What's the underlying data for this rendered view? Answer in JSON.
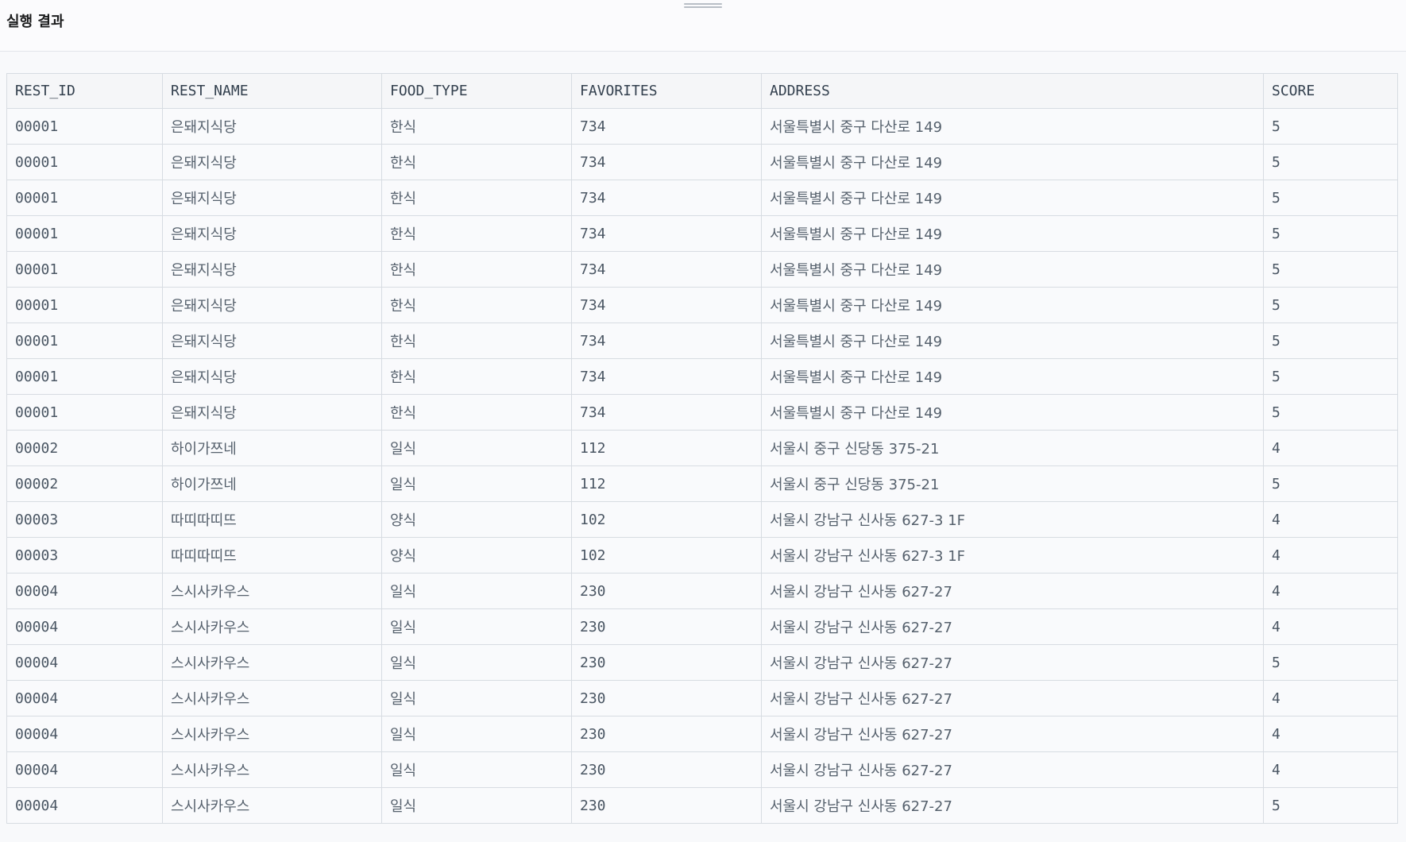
{
  "panel": {
    "title": "실행 결과"
  },
  "table": {
    "columns": [
      "REST_ID",
      "REST_NAME",
      "FOOD_TYPE",
      "FAVORITES",
      "ADDRESS",
      "SCORE"
    ],
    "rows": [
      [
        "00001",
        "은돼지식당",
        "한식",
        "734",
        "서울특별시 중구 다산로 149",
        "5"
      ],
      [
        "00001",
        "은돼지식당",
        "한식",
        "734",
        "서울특별시 중구 다산로 149",
        "5"
      ],
      [
        "00001",
        "은돼지식당",
        "한식",
        "734",
        "서울특별시 중구 다산로 149",
        "5"
      ],
      [
        "00001",
        "은돼지식당",
        "한식",
        "734",
        "서울특별시 중구 다산로 149",
        "5"
      ],
      [
        "00001",
        "은돼지식당",
        "한식",
        "734",
        "서울특별시 중구 다산로 149",
        "5"
      ],
      [
        "00001",
        "은돼지식당",
        "한식",
        "734",
        "서울특별시 중구 다산로 149",
        "5"
      ],
      [
        "00001",
        "은돼지식당",
        "한식",
        "734",
        "서울특별시 중구 다산로 149",
        "5"
      ],
      [
        "00001",
        "은돼지식당",
        "한식",
        "734",
        "서울특별시 중구 다산로 149",
        "5"
      ],
      [
        "00001",
        "은돼지식당",
        "한식",
        "734",
        "서울특별시 중구 다산로 149",
        "5"
      ],
      [
        "00002",
        "하이가쯔네",
        "일식",
        "112",
        "서울시 중구 신당동 375-21",
        "4"
      ],
      [
        "00002",
        "하이가쯔네",
        "일식",
        "112",
        "서울시 중구 신당동 375-21",
        "5"
      ],
      [
        "00003",
        "따띠따띠뜨",
        "양식",
        "102",
        "서울시 강남구 신사동 627-3 1F",
        "4"
      ],
      [
        "00003",
        "따띠따띠뜨",
        "양식",
        "102",
        "서울시 강남구 신사동 627-3 1F",
        "4"
      ],
      [
        "00004",
        "스시사카우스",
        "일식",
        "230",
        "서울시 강남구 신사동 627-27",
        "4"
      ],
      [
        "00004",
        "스시사카우스",
        "일식",
        "230",
        "서울시 강남구 신사동 627-27",
        "4"
      ],
      [
        "00004",
        "스시사카우스",
        "일식",
        "230",
        "서울시 강남구 신사동 627-27",
        "5"
      ],
      [
        "00004",
        "스시사카우스",
        "일식",
        "230",
        "서울시 강남구 신사동 627-27",
        "4"
      ],
      [
        "00004",
        "스시사카우스",
        "일식",
        "230",
        "서울시 강남구 신사동 627-27",
        "4"
      ],
      [
        "00004",
        "스시사카우스",
        "일식",
        "230",
        "서울시 강남구 신사동 627-27",
        "4"
      ],
      [
        "00004",
        "스시사카우스",
        "일식",
        "230",
        "서울시 강남구 신사동 627-27",
        "5"
      ]
    ]
  }
}
